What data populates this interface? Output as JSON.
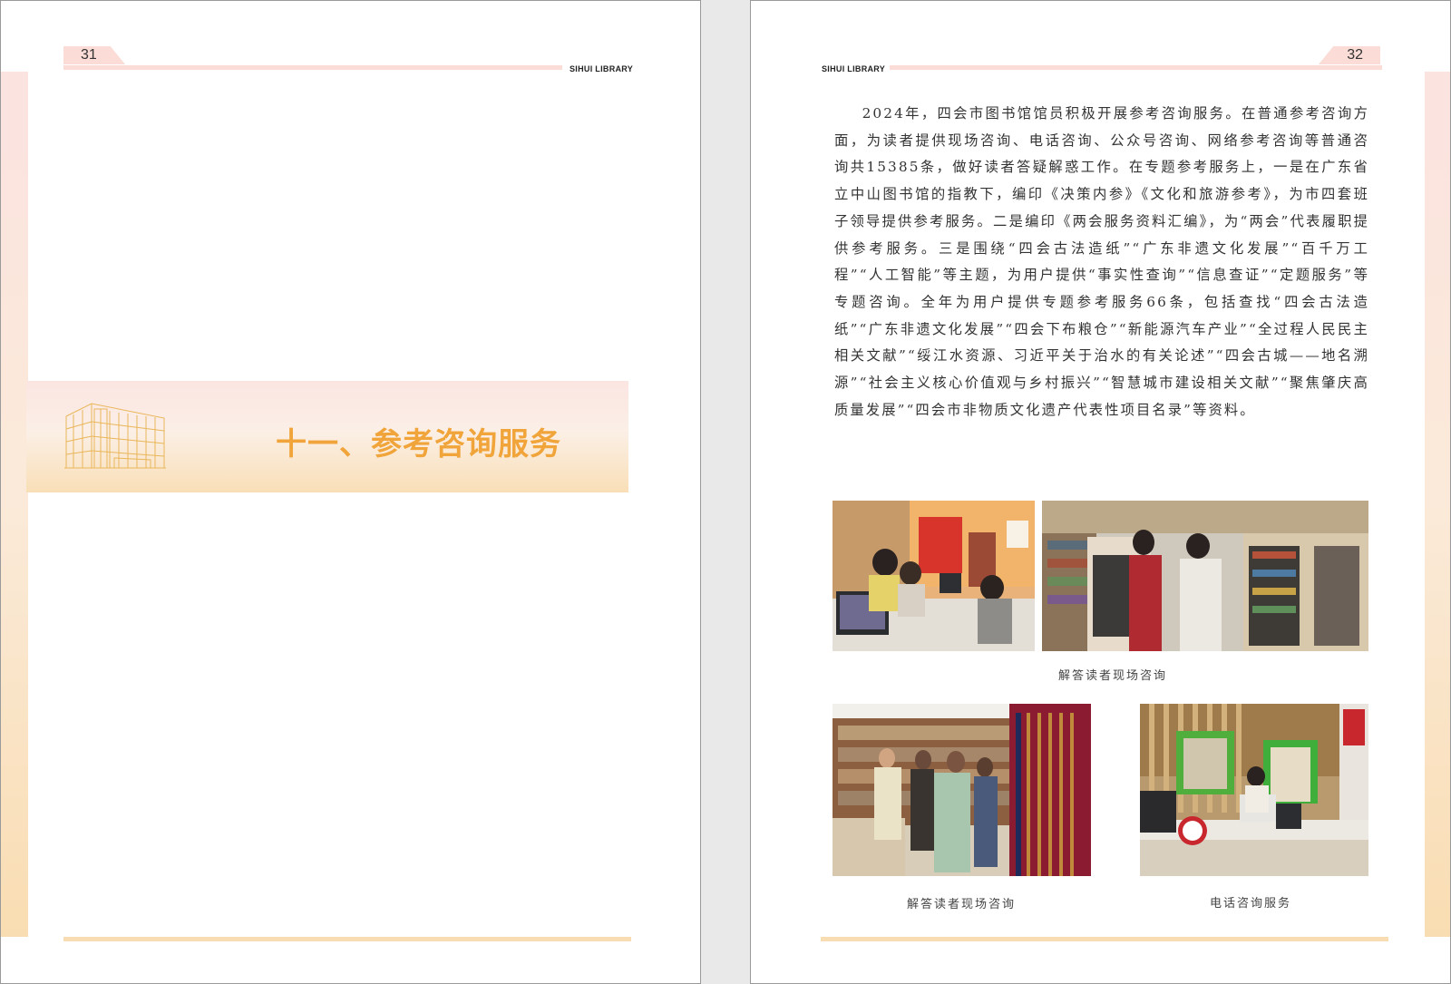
{
  "left_page": {
    "page_number": "31",
    "header_label": "SIHUI LIBRARY",
    "chapter_title": "十一、参考咨询服务",
    "icon": "library-building-icon"
  },
  "right_page": {
    "page_number": "32",
    "header_label": "SIHUI LIBRARY",
    "body_text": "2024年，四会市图书馆馆员积极开展参考咨询服务。在普通参考咨询方面，为读者提供现场咨询、电话咨询、公众号咨询、网络参考咨询等普通咨询共15385条，做好读者答疑解惑工作。在专题参考服务上，一是在广东省立中山图书馆的指教下，编印《决策内参》《文化和旅游参考》，为市四套班子领导提供参考服务。二是编印《两会服务资料汇编》，为“两会”代表履职提供参考服务。三是围绕“四会古法造纸”“广东非遗文化发展”“百千万工程”“人工智能”等主题，为用户提供“事实性查询”“信息查证”“定题服务”等专题咨询。全年为用户提供专题参考服务66条，包括查找“四会古法造纸”“广东非遗文化发展”“四会下布粮仓”“新能源汽车产业”“全过程人民民主相关文献”“绥江水资源、习近平关于治水的有关论述”“四会古城——地名溯源”“社会主义核心价值观与乡村振兴”“智慧城市建设相关文献”“聚焦肇庆高质量发展”“四会市非物质文化遗产代表性项目名录”等资料。",
    "captions": [
      "解答读者现场咨询",
      "解答读者现场咨询",
      "电话咨询服务"
    ]
  },
  "colors": {
    "chapter_title": "#f0a43a",
    "header_line": "#fbdcd6",
    "footer_line": "#f9ddb2",
    "text": "#333333"
  }
}
